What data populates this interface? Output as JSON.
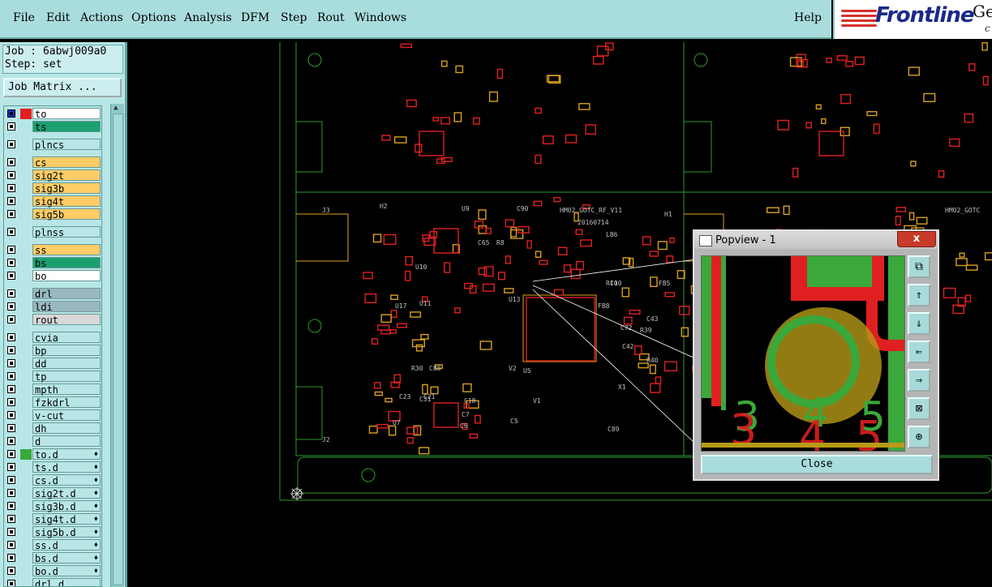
{
  "menu": {
    "items": [
      "File",
      "Edit",
      "Actions",
      "Options",
      "Analysis",
      "DFM",
      "Step",
      "Rout",
      "Windows"
    ],
    "help": "Help"
  },
  "brand": {
    "logo": "Frontline",
    "partial": "Ge",
    "partial2": "c"
  },
  "job": {
    "job_line": "Job : 6abwj009a0",
    "step_line": "Step: set",
    "matrix_button": "Job Matrix ..."
  },
  "layers": [
    {
      "name": "to",
      "color": "#ffffff",
      "swatch": "#e02020",
      "selected": true
    },
    {
      "name": "ts",
      "color": "#1aa070",
      "swatch": ""
    },
    {
      "name": "plncs",
      "color": "#b8e6e6",
      "swatch": ""
    },
    {
      "name": "cs",
      "color": "#ffcc66",
      "swatch": ""
    },
    {
      "name": "sig2t",
      "color": "#ffcc66",
      "swatch": ""
    },
    {
      "name": "sig3b",
      "color": "#ffcc66",
      "swatch": ""
    },
    {
      "name": "sig4t",
      "color": "#ffcc66",
      "swatch": ""
    },
    {
      "name": "sig5b",
      "color": "#ffcc66",
      "swatch": ""
    },
    {
      "name": "plnss",
      "color": "#b8e6e6",
      "swatch": ""
    },
    {
      "name": "ss",
      "color": "#ffcc66",
      "swatch": ""
    },
    {
      "name": "bs",
      "color": "#1aa070",
      "swatch": ""
    },
    {
      "name": "bo",
      "color": "#ffffff",
      "swatch": ""
    },
    {
      "name": "drl",
      "color": "#9ab8c0",
      "swatch": ""
    },
    {
      "name": "ldi",
      "color": "#9ab8c0",
      "swatch": ""
    },
    {
      "name": "rout",
      "color": "#d8d8d8",
      "swatch": ""
    },
    {
      "name": "cvia",
      "color": "#b8e6e6",
      "swatch": ""
    },
    {
      "name": "bp",
      "color": "#b8e6e6",
      "swatch": ""
    },
    {
      "name": "dd",
      "color": "#b8e6e6",
      "swatch": ""
    },
    {
      "name": "tp",
      "color": "#b8e6e6",
      "swatch": ""
    },
    {
      "name": "mpth",
      "color": "#b8e6e6",
      "swatch": ""
    },
    {
      "name": "fzkdrl",
      "color": "#b8e6e6",
      "swatch": ""
    },
    {
      "name": "v-cut",
      "color": "#b8e6e6",
      "swatch": ""
    },
    {
      "name": "dh",
      "color": "#b8e6e6",
      "swatch": ""
    },
    {
      "name": "d",
      "color": "#b8e6e6",
      "swatch": ""
    },
    {
      "name": "to.d",
      "color": "#b8e6e6",
      "swatch": "#3aa83a",
      "flag": "♦"
    },
    {
      "name": "ts.d",
      "color": "#b8e6e6",
      "swatch": "",
      "flag": "♦"
    },
    {
      "name": "cs.d",
      "color": "#b8e6e6",
      "swatch": "",
      "flag": "♦"
    },
    {
      "name": "sig2t.d",
      "color": "#b8e6e6",
      "swatch": "",
      "flag": "♦"
    },
    {
      "name": "sig3b.d",
      "color": "#b8e6e6",
      "swatch": "",
      "flag": "♦"
    },
    {
      "name": "sig4t.d",
      "color": "#b8e6e6",
      "swatch": "",
      "flag": "♦"
    },
    {
      "name": "sig5b.d",
      "color": "#b8e6e6",
      "swatch": "",
      "flag": "♦"
    },
    {
      "name": "ss.d",
      "color": "#b8e6e6",
      "swatch": "",
      "flag": "♦"
    },
    {
      "name": "bs.d",
      "color": "#b8e6e6",
      "swatch": "",
      "flag": "♦"
    },
    {
      "name": "bo.d",
      "color": "#b8e6e6",
      "swatch": "",
      "flag": "♦"
    },
    {
      "name": "drl.d",
      "color": "#b8e6e6",
      "swatch": ""
    }
  ],
  "pcb": {
    "text_labels": [
      "HM02_GOTC_RF_V11",
      "20160714",
      "HM02_GOTC",
      "LB6",
      "U13",
      "U5",
      "U7",
      "U9",
      "U10",
      "U11",
      "U17",
      "J2",
      "J3",
      "H2",
      "H1",
      "X1",
      "C43",
      "R39",
      "R40",
      "C42",
      "C72",
      "C89",
      "FB5",
      "FB8",
      "R30",
      "C88",
      "C31",
      "C23",
      "C21",
      "C18",
      "C7",
      "C6",
      "C5",
      "V1",
      "V2",
      "C90",
      "C65",
      "R8",
      "R10",
      "C10"
    ]
  },
  "popview": {
    "title": "Popview - 1",
    "close_x": "x",
    "close_button": "Close",
    "pad_numbers": [
      "3",
      "4",
      "5"
    ],
    "tools": [
      "zoom-fit-icon",
      "move-up-icon",
      "move-down-icon",
      "move-left-icon",
      "move-right-icon",
      "zoom-out-icon",
      "zoom-in-icon"
    ]
  }
}
